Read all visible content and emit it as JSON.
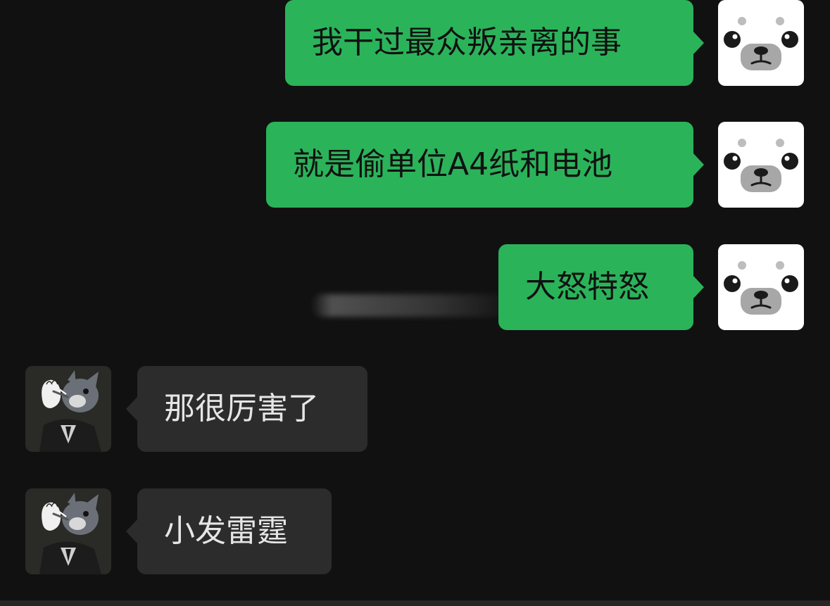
{
  "chat": {
    "messages": [
      {
        "direction": "outgoing",
        "text": "我干过最众叛亲离的事"
      },
      {
        "direction": "outgoing",
        "text": "就是偷单位A4纸和电池"
      },
      {
        "direction": "outgoing",
        "text": "大怒特怒"
      },
      {
        "direction": "incoming",
        "text": "那很厉害了"
      },
      {
        "direction": "incoming",
        "text": "小发雷霆"
      }
    ]
  },
  "avatars": {
    "self": "seal-face-icon",
    "contact": "cartoon-cat-portrait-icon"
  },
  "colors": {
    "background": "#111111",
    "outgoing_bubble": "#2bb35a",
    "incoming_bubble": "#2c2c2c",
    "incoming_text": "#e6e6e6",
    "outgoing_text": "#111111"
  }
}
